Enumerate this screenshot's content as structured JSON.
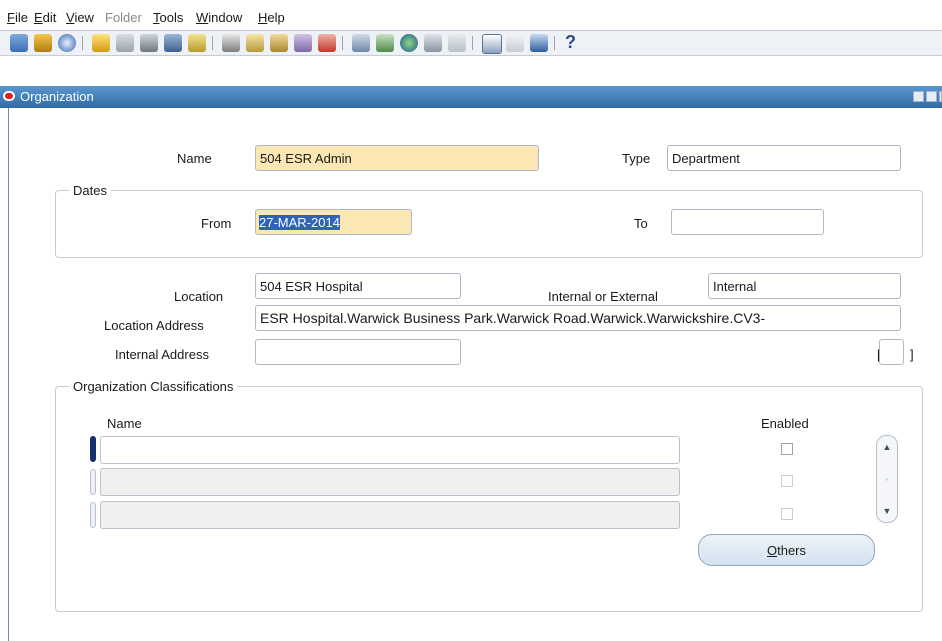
{
  "menu": {
    "items": [
      {
        "label": "File",
        "mnemonic": "F",
        "rest": "ile",
        "enabled": true
      },
      {
        "label": "Edit",
        "mnemonic": "E",
        "rest": "dit",
        "enabled": true
      },
      {
        "label": "View",
        "mnemonic": "V",
        "rest": "iew",
        "enabled": true
      },
      {
        "label": "Folder",
        "mnemonic": "",
        "rest": "Folder",
        "enabled": false
      },
      {
        "label": "Tools",
        "mnemonic": "T",
        "rest": "ools",
        "enabled": true
      },
      {
        "label": "Window",
        "mnemonic": "W",
        "rest": "indow",
        "enabled": true
      },
      {
        "label": "Help",
        "mnemonic": "H",
        "rest": "elp",
        "enabled": true
      }
    ]
  },
  "toolbar": {
    "icons": [
      "new-record-icon",
      "find-icon",
      "navigator-icon",
      "save-icon",
      "next-step-icon",
      "switch-responsibility-icon",
      "print-icon",
      "close-form-icon",
      "cut-icon",
      "copy-icon",
      "paste-icon",
      "clear-record-icon",
      "delete-record-icon",
      "edit-field-icon",
      "zoom-icon",
      "translations-icon",
      "attachments-icon",
      "folder-tools-icon",
      "calendar-icon",
      "calendar-icon-2",
      "export-icon",
      "help-icon"
    ],
    "help_glyph": "?"
  },
  "window": {
    "title": "Organization"
  },
  "form": {
    "name_label": "Name",
    "name_value": "504 ESR Admin",
    "type_label": "Type",
    "type_value": "Department",
    "dates_group": "Dates",
    "from_label": "From",
    "from_value": "27-MAR-2014",
    "to_label": "To",
    "to_value": "",
    "location_label": "Location",
    "location_value": "504 ESR Hospital",
    "int_ext_label": "Internal or External",
    "int_ext_value": "Internal",
    "loc_address_label": "Location Address",
    "loc_address_value": "ESR Hospital.Warwick Business Park.Warwick Road.Warwick.Warwickshire.CV3-",
    "internal_address_label": "Internal Address",
    "internal_address_value": "",
    "bracket_open": "[",
    "bracket_close": "]"
  },
  "classifications": {
    "group_title": "Organization Classifications",
    "name_header": "Name",
    "enabled_header": "Enabled",
    "rows": [
      {
        "name": "",
        "enabled": false
      },
      {
        "name": "",
        "enabled": false
      },
      {
        "name": "",
        "enabled": false
      }
    ],
    "others_button": "Others",
    "others_mnemonic": "O",
    "others_rest": "thers"
  },
  "colors": {
    "title_bar": "#3473ad",
    "required_field": "#fbe7b3",
    "selection": "#2f63b8"
  }
}
